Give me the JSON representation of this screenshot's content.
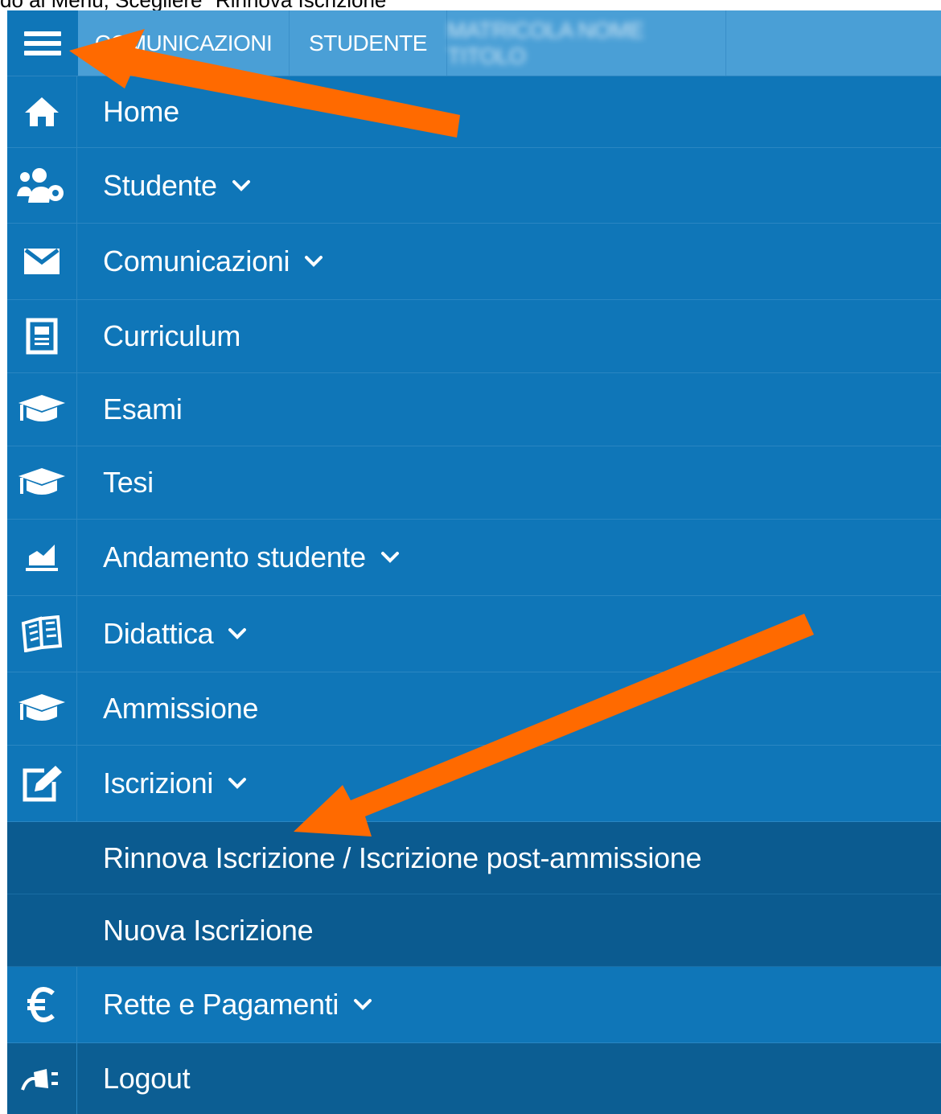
{
  "caption": "do al Menù, Scegliere \"Rinnova Iscrizione\"",
  "topbar": {
    "menu_icon": "hamburger-icon",
    "tabs": [
      {
        "label": "COMUNICAZIONI"
      },
      {
        "label": "STUDENTE"
      },
      {
        "label": "MATRICOLA NOME TITOLO"
      }
    ]
  },
  "menu": {
    "items": [
      {
        "label": "Home",
        "icon": "home-icon"
      },
      {
        "label": "Studente",
        "icon": "users-gear-icon",
        "expandable": true
      },
      {
        "label": "Comunicazioni",
        "icon": "envelope-icon",
        "expandable": true
      },
      {
        "label": "Curriculum",
        "icon": "document-icon"
      },
      {
        "label": "Esami",
        "icon": "graduation-cap-icon"
      },
      {
        "label": "Tesi",
        "icon": "graduation-cap-icon"
      },
      {
        "label": "Andamento studente",
        "icon": "area-chart-icon",
        "expandable": true
      },
      {
        "label": "Didattica",
        "icon": "open-book-icon",
        "expandable": true
      },
      {
        "label": "Ammissione",
        "icon": "graduation-cap-icon"
      },
      {
        "label": "Iscrizioni",
        "icon": "edit-icon",
        "expandable": true,
        "expanded": true
      },
      {
        "label": "Rinnova Iscrizione / Iscrizione post-ammissione",
        "submenu_of": "Iscrizioni"
      },
      {
        "label": "Nuova Iscrizione",
        "submenu_of": "Iscrizioni"
      },
      {
        "label": "Rette e Pagamenti",
        "icon": "euro-icon",
        "expandable": true
      },
      {
        "label": "Logout",
        "icon": "plug-icon"
      }
    ]
  },
  "colors": {
    "menu_bg": "#0f76b8",
    "submenu_bg": "#0b5b90",
    "topbar_bg": "#4a9fd6",
    "arrow": "#ff6a00"
  }
}
